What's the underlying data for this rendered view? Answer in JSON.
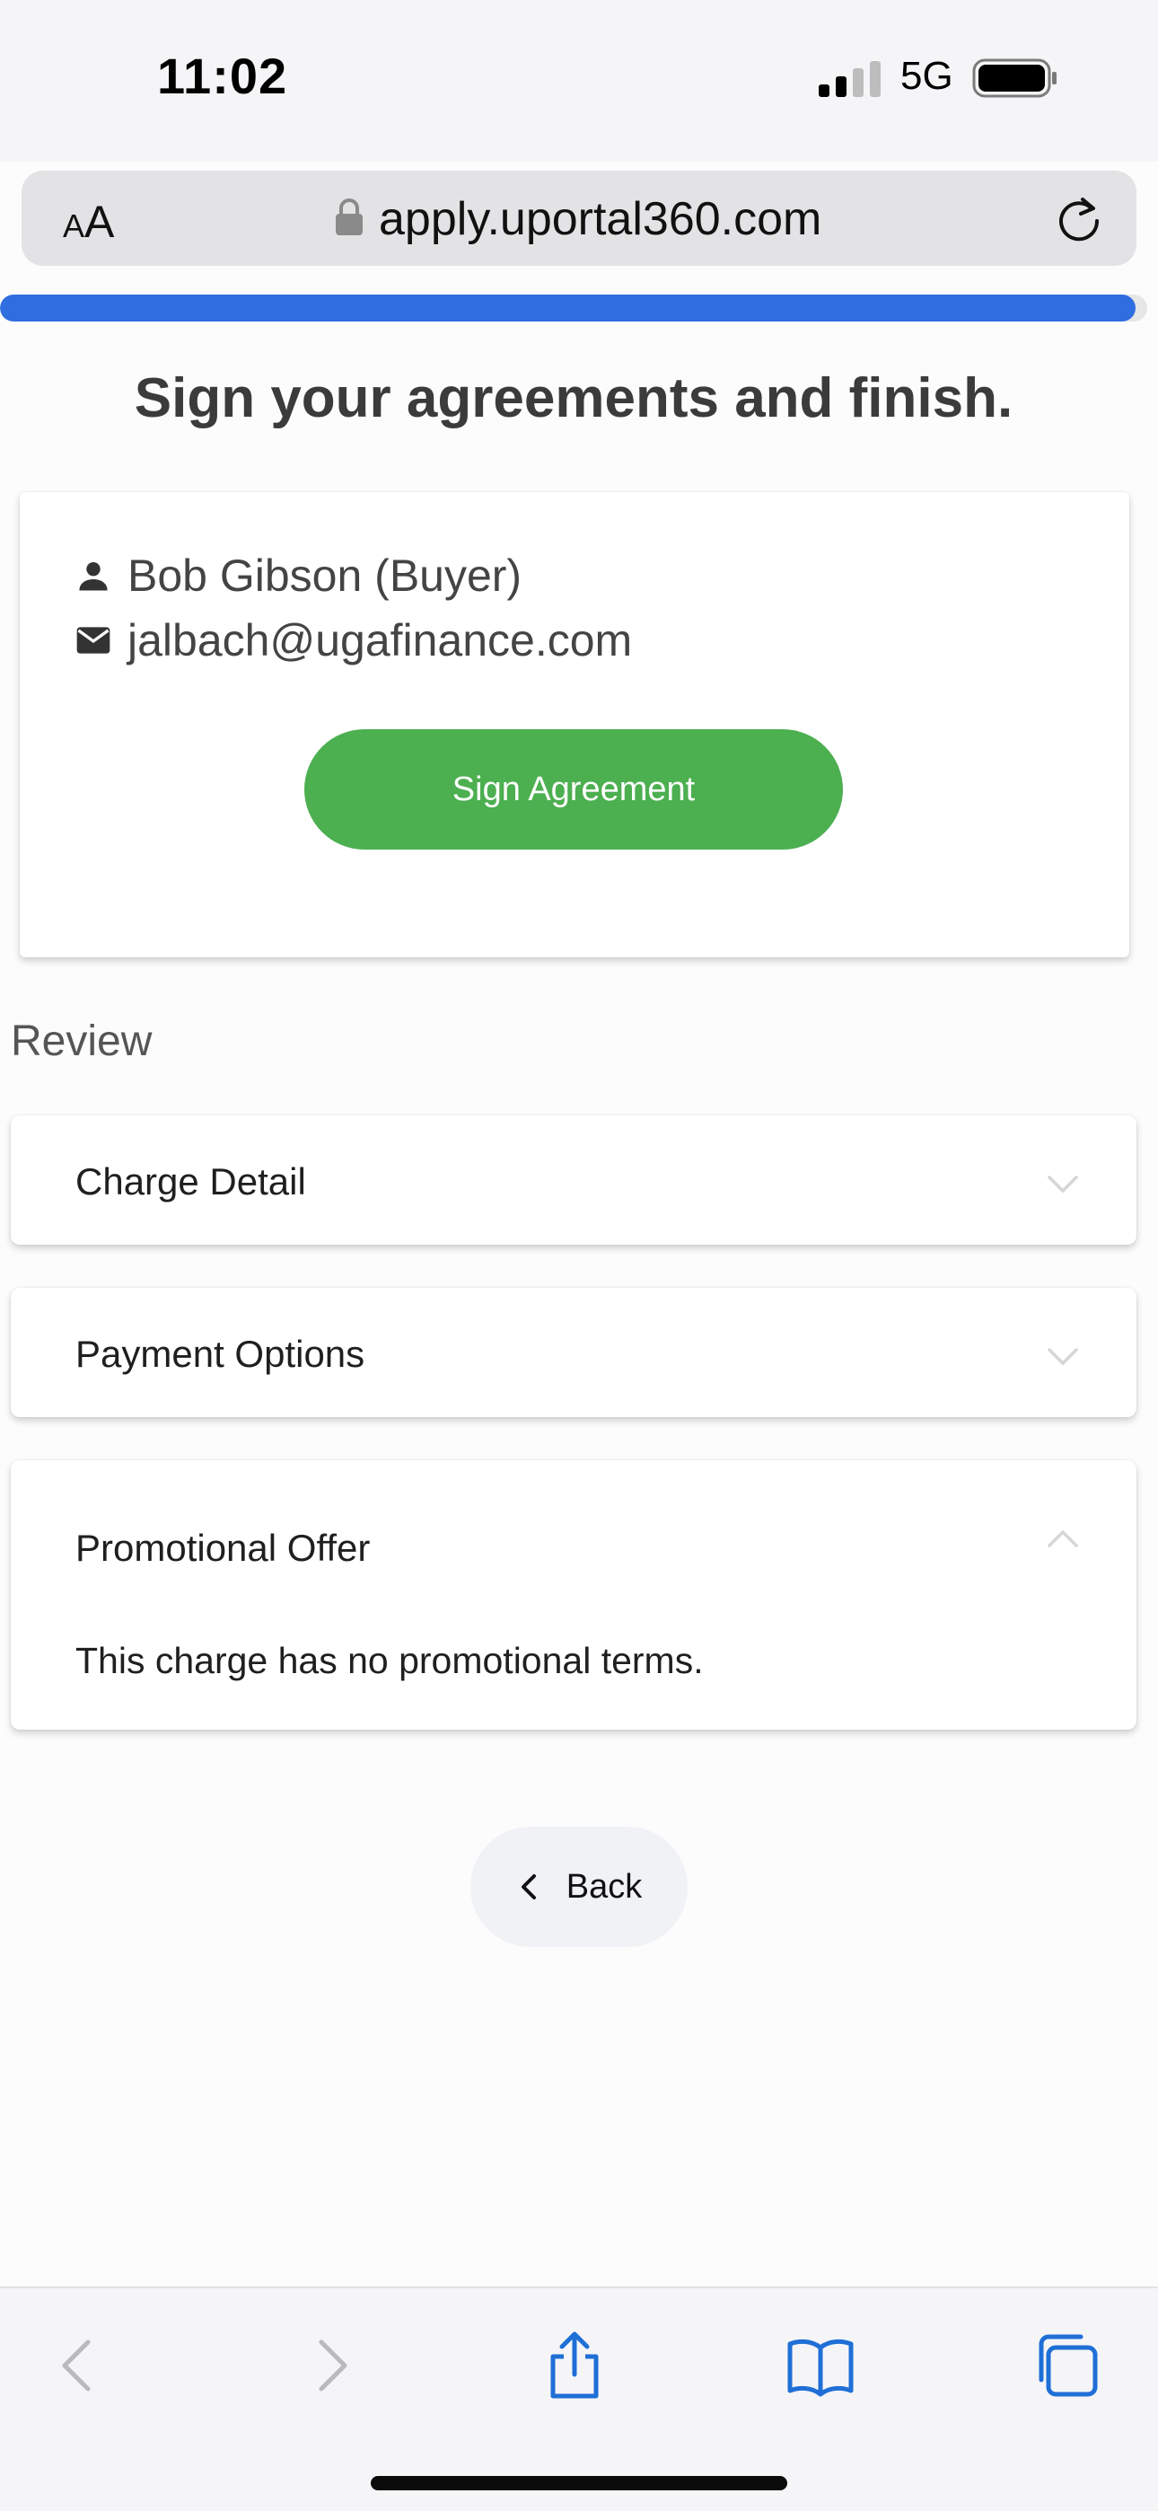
{
  "status_bar": {
    "time": "11:02",
    "network": "5G",
    "signal_icon": "cellular-signal-icon",
    "battery_icon": "battery-icon"
  },
  "browser": {
    "text_size_small": "A",
    "text_size_big": "A",
    "url": "apply.uportal360.com",
    "lock_icon": "lock-icon",
    "reload_icon": "reload-icon"
  },
  "progress": {
    "fraction": 0.99
  },
  "page": {
    "title": "Sign your agreements and finish.",
    "accent_color": "#2f6ee0",
    "button_color": "#4caf50"
  },
  "signer": {
    "name": "Bob Gibson (Buyer)",
    "email": "jalbach@ugafinance.com",
    "name_icon": "person-icon",
    "email_icon": "mail-icon",
    "sign_label": "Sign Agreement"
  },
  "review": {
    "label": "Review",
    "sections": [
      {
        "title": "Charge Detail",
        "expanded": false,
        "body": ""
      },
      {
        "title": "Payment Options",
        "expanded": false,
        "body": ""
      },
      {
        "title": "Promotional Offer",
        "expanded": true,
        "body": "This charge has no promotional terms."
      }
    ]
  },
  "back": {
    "label": "Back",
    "icon": "chevron-left-icon"
  },
  "toolbar": {
    "items": [
      "back-arrow-icon",
      "forward-arrow-icon",
      "share-icon",
      "bookmarks-icon",
      "tabs-icon"
    ]
  }
}
